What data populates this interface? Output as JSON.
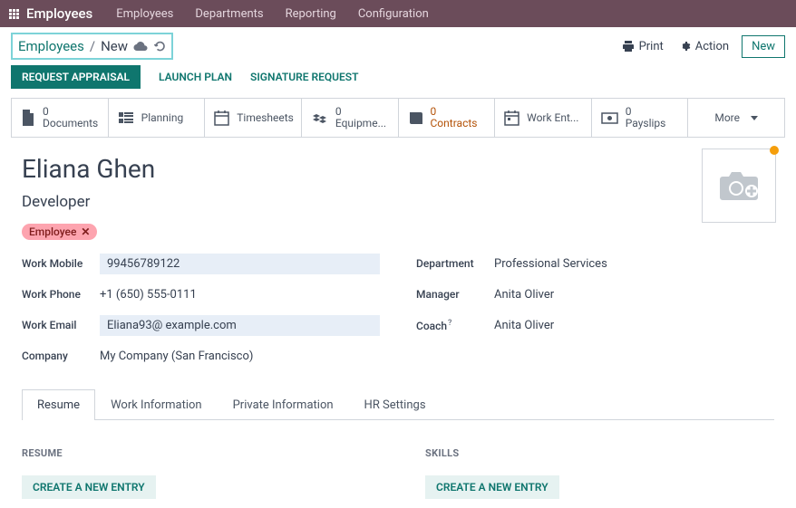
{
  "nav": {
    "brand": "Employees",
    "links": [
      "Employees",
      "Departments",
      "Reporting",
      "Configuration"
    ]
  },
  "breadcrumb": {
    "root": "Employees",
    "current": "New"
  },
  "toolbar": {
    "print": "Print",
    "action": "Action",
    "new": "New"
  },
  "actions": {
    "request_appraisal": "REQUEST APPRAISAL",
    "launch_plan": "LAUNCH PLAN",
    "signature_request": "SIGNATURE REQUEST"
  },
  "stats": {
    "documents": {
      "count": "0",
      "label": "Documents"
    },
    "planning": {
      "label": "Planning"
    },
    "timesheets": {
      "label": "Timesheets"
    },
    "equipment": {
      "count": "0",
      "label": "Equipme..."
    },
    "contracts": {
      "count": "0",
      "label": "Contracts"
    },
    "work_entries": {
      "label": "Work Ent..."
    },
    "payslips": {
      "count": "0",
      "label": "Payslips"
    },
    "more": "More"
  },
  "employee": {
    "name": "Eliana Ghen",
    "title": "Developer",
    "tag": "Employee"
  },
  "fields_left": {
    "work_mobile": {
      "label": "Work Mobile",
      "value": "99456789122"
    },
    "work_phone": {
      "label": "Work Phone",
      "value": "+1 (650) 555-0111"
    },
    "work_email": {
      "label": "Work Email",
      "value": "Eliana93@ example.com"
    },
    "company": {
      "label": "Company",
      "value": "My Company (San Francisco)"
    }
  },
  "fields_right": {
    "department": {
      "label": "Department",
      "value": "Professional Services"
    },
    "manager": {
      "label": "Manager",
      "value": "Anita Oliver"
    },
    "coach": {
      "label": "Coach",
      "value": "Anita Oliver"
    }
  },
  "tabs": [
    "Resume",
    "Work Information",
    "Private Information",
    "HR Settings"
  ],
  "resume": {
    "heading": "RESUME",
    "create": "CREATE A NEW ENTRY"
  },
  "skills": {
    "heading": "SKILLS",
    "create": "CREATE A NEW ENTRY"
  }
}
